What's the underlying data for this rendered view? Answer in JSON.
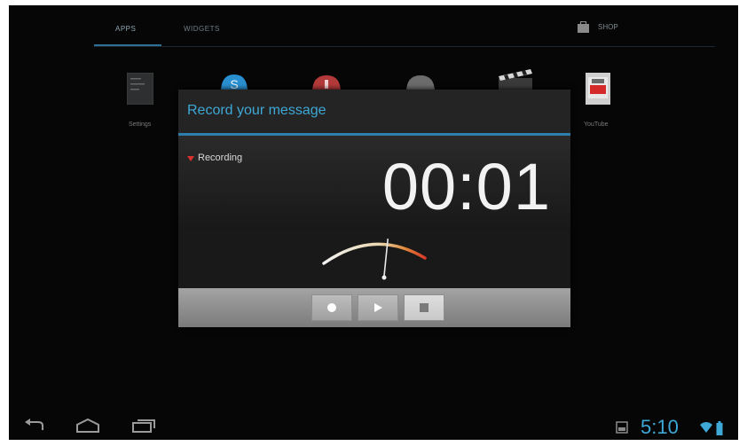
{
  "launcher": {
    "tabs": [
      {
        "label": "APPS",
        "active": true
      },
      {
        "label": "WIDGETS",
        "active": false
      }
    ],
    "shop_label": "SHOP",
    "apps": [
      {
        "name": "settings",
        "label": "Settings"
      },
      {
        "name": "skype",
        "label": ""
      },
      {
        "name": "app-red",
        "label": ""
      },
      {
        "name": "app-gray",
        "label": ""
      },
      {
        "name": "clapper",
        "label": ""
      },
      {
        "name": "youtube",
        "label": "YouTube"
      }
    ]
  },
  "dialog": {
    "title": "Record your message",
    "status_label": "Recording",
    "timer": "00:01",
    "level": 0.55,
    "controls": [
      "record",
      "play",
      "stop"
    ]
  },
  "status_bar": {
    "clock": "5:10"
  },
  "colors": {
    "accent": "#3ea8d6",
    "recording": "#d93030",
    "background": "#060606"
  },
  "icons": [
    "back-icon",
    "home-icon",
    "recent-apps-icon",
    "gallery-icon",
    "wifi-icon",
    "battery-icon"
  ]
}
